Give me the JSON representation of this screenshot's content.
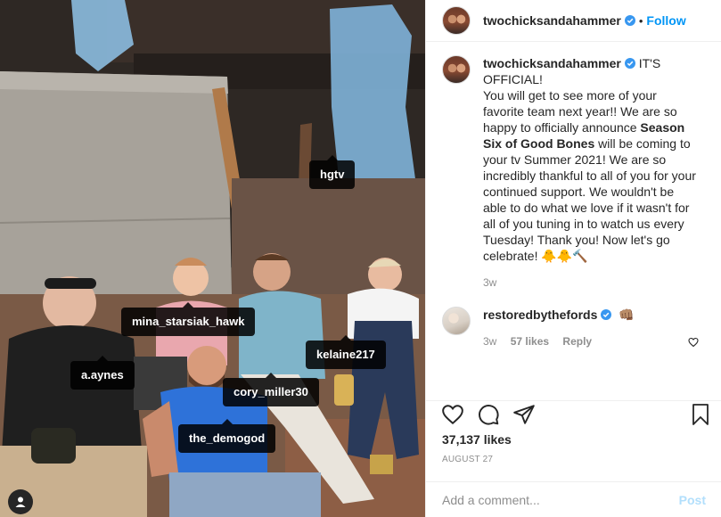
{
  "post": {
    "author": "twochicksandahammer",
    "follow_label": "Follow",
    "separator": "•",
    "caption_heading": "IT'S OFFICIAL!",
    "caption_part1": "You will get to see more of your favorite team next year!! We are so happy to officially announce ",
    "caption_bold": "Season Six of Good Bones",
    "caption_part2": " will be coming to your tv Summer 2021! We are so incredibly thankful to all of you for your continued support. We wouldn't be able to do what we love if it wasn't for all of you tuning in to watch us every Tuesday! Thank you! Now let's go celebrate! 🐥🐥🔨",
    "caption_age": "3w",
    "likes": "37,137 likes",
    "date": "AUGUST 27"
  },
  "photo_tags": {
    "hgtv": "hgtv",
    "mina": "mina_starsiak_hawk",
    "kelaine": "kelaine217",
    "aaynes": "a.aynes",
    "cory": "cory_miller30",
    "demogod": "the_demogod"
  },
  "comment": {
    "author": "restoredbythefords",
    "text": "👊🏽",
    "age": "3w",
    "likes": "57 likes",
    "reply_label": "Reply"
  },
  "add_comment": {
    "placeholder": "Add a comment...",
    "post_label": "Post"
  },
  "colors": {
    "accent": "#0095f6",
    "post_disabled": "#b2dffc",
    "muted": "#8e8e8e",
    "text": "#262626"
  }
}
